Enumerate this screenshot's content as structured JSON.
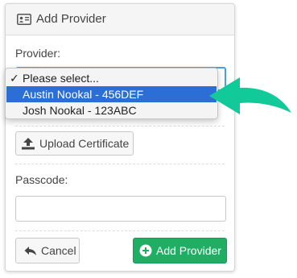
{
  "panel": {
    "title": "Add Provider",
    "provider_label": "Provider:",
    "upload_label": "Upload Certificate",
    "passcode_label": "Passcode:",
    "passcode_value": "",
    "cancel_label": "Cancel",
    "submit_label": "Add Provider"
  },
  "dropdown": {
    "options": [
      {
        "label": "Please select...",
        "checked": true,
        "highlighted": false
      },
      {
        "label": "Austin Nookal - 456DEF",
        "checked": false,
        "highlighted": true
      },
      {
        "label": "Josh Nookal - 123ABC",
        "checked": false,
        "highlighted": false
      }
    ],
    "check_mark": "✓"
  },
  "colors": {
    "primary": "#1fae63",
    "highlight": "#2b6fd6",
    "focus_border": "#4a9fe0",
    "annotation_arrow": "#12c99a"
  }
}
